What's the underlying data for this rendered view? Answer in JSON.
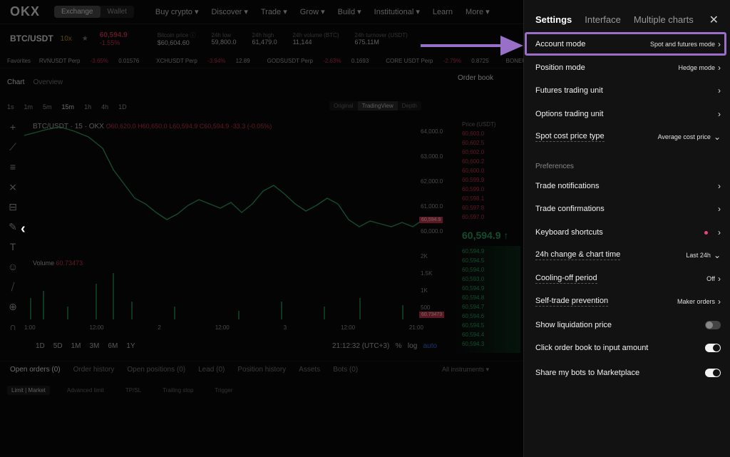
{
  "topnav": {
    "logo": "OKX",
    "seg": [
      "Exchange",
      "Wallet"
    ],
    "items": [
      "Buy crypto",
      "Discover",
      "Trade",
      "Grow",
      "Build",
      "Institutional",
      "Learn",
      "More"
    ]
  },
  "ticker": {
    "pair": "BTC/USDT",
    "tag": "10x",
    "price": "60,594.9",
    "change": "-1.55%",
    "stats": [
      {
        "k": "Bitcoin price ⓘ",
        "v": "$60,604.60"
      },
      {
        "k": "24h low",
        "v": "59,800.0"
      },
      {
        "k": "24h high",
        "v": "61,479.0"
      },
      {
        "k": "24h volume (BTC)",
        "v": "11,144"
      },
      {
        "k": "24h turnover (USDT)",
        "v": "675.11M"
      }
    ]
  },
  "favorites": {
    "label": "Favorites",
    "items": [
      {
        "name": "RVNUSDT Perp",
        "ch": "-3.65%",
        "p": "0.01576"
      },
      {
        "name": "XCHUSDT Perp",
        "ch": "-3.94%",
        "p": "12.89"
      },
      {
        "name": "GODSUSDT Perp",
        "ch": "-2.63%",
        "p": "0.1693"
      },
      {
        "name": "CORE USDT Perp",
        "ch": "-2.79%",
        "p": "0.8725"
      },
      {
        "name": "BONEUSDT Perp",
        "ch": "",
        "p": ""
      }
    ]
  },
  "chart": {
    "tabs": [
      "Chart",
      "Overview"
    ],
    "intervals": [
      "1s",
      "1m",
      "5m",
      "15m",
      "1h",
      "4h",
      "1D"
    ],
    "views": [
      "Original",
      "TradingView",
      "Depth"
    ],
    "legend_pair": "BTC/USDT · 15 · OKX",
    "legend_ohlc": "O60,620.0 H60,650.0 L60,594.9 C60,594.9 -33.3 (-0.05%)",
    "yaxis": [
      "64,000.0",
      "63,000.0",
      "62,000.0",
      "61,000.0",
      "60,000.0"
    ],
    "price_mark": "60,594.9",
    "vol_axis": [
      "2K",
      "1.5K",
      "1K",
      "500"
    ],
    "vol_mark": "60.73473",
    "volume_label": "Volume",
    "volume_value": "60.73473",
    "xaxis": [
      "1:00",
      "12:00",
      "2",
      "12:00",
      "3",
      "12:00",
      "21:00"
    ],
    "ranges": [
      "1D",
      "5D",
      "1M",
      "3M",
      "6M",
      "1Y"
    ],
    "time": "21:12:32 (UTC+3)",
    "pct": "%",
    "log": "log",
    "auto": "auto"
  },
  "orderbook": {
    "title": "Order book",
    "col": "Price (USDT)",
    "sells": [
      "60,603.0",
      "60,602.5",
      "60,602.0",
      "60,600.2",
      "60,600.0",
      "60,599.9",
      "60,599.0",
      "60,598.1",
      "60,597.8",
      "60,597.0"
    ],
    "mid": "60,594.9 ↑",
    "buys": [
      "60,594.9",
      "60,594.5",
      "60,594.0",
      "60,593.0",
      "60,594.9",
      "60,594.8",
      "60,594.7",
      "60,594.6",
      "60,594.5",
      "60,594.4",
      "60,594.3"
    ]
  },
  "bottom": {
    "tabs": [
      "Open orders (0)",
      "Order history",
      "Open positions (0)",
      "Lead (0)",
      "Position history",
      "Assets",
      "Bots (0)"
    ],
    "instruments": "All instruments",
    "subtabs": [
      "Limit | Market",
      "Advanced limit",
      "TP/SL",
      "Trailing stop",
      "Trigger"
    ]
  },
  "settings": {
    "tabs": [
      "Settings",
      "Interface",
      "Multiple charts"
    ],
    "close": "✕",
    "rows": [
      {
        "label": "Account mode",
        "value": "Spot and futures mode"
      },
      {
        "label": "Position mode",
        "value": "Hedge mode"
      },
      {
        "label": "Futures trading unit",
        "value": ""
      },
      {
        "label": "Options trading unit",
        "value": ""
      },
      {
        "label": "Spot cost price type",
        "value": "Average cost price"
      }
    ],
    "preferences_label": "Preferences",
    "prefs": [
      {
        "label": "Trade notifications",
        "value": ""
      },
      {
        "label": "Trade confirmations",
        "value": ""
      },
      {
        "label": "Keyboard shortcuts",
        "value": ""
      },
      {
        "label": "24h change & chart time",
        "value": "Last 24h"
      },
      {
        "label": "Cooling-off period",
        "value": "Off"
      },
      {
        "label": "Self-trade prevention",
        "value": "Maker orders"
      },
      {
        "label": "Show liquidation price",
        "value": ""
      },
      {
        "label": "Click order book to input amount",
        "value": ""
      },
      {
        "label": "Share my bots to Marketplace",
        "value": ""
      }
    ],
    "toggles": {
      "liquidation": false,
      "click_order_book": true,
      "share_bots": true
    }
  },
  "colors": {
    "highlight": "#9a6fc8",
    "sell": "#e03a55",
    "buy": "#2fb36b"
  }
}
